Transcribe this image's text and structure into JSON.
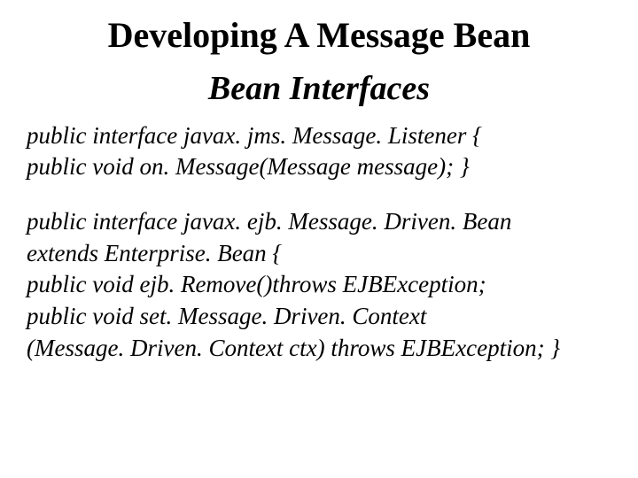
{
  "title": "Developing A Message Bean",
  "subtitle": "Bean Interfaces",
  "block1": {
    "line1": "public interface javax. jms. Message. Listener {",
    "line2": "public void on. Message(Message message); }"
  },
  "block2": {
    "line1": "public interface javax. ejb. Message. Driven. Bean",
    "line2": "extends Enterprise. Bean {",
    "line3": "public void ejb. Remove()throws EJBException;",
    "line4": "public void set. Message. Driven. Context",
    "line5": "(Message. Driven. Context ctx) throws EJBException; }"
  }
}
